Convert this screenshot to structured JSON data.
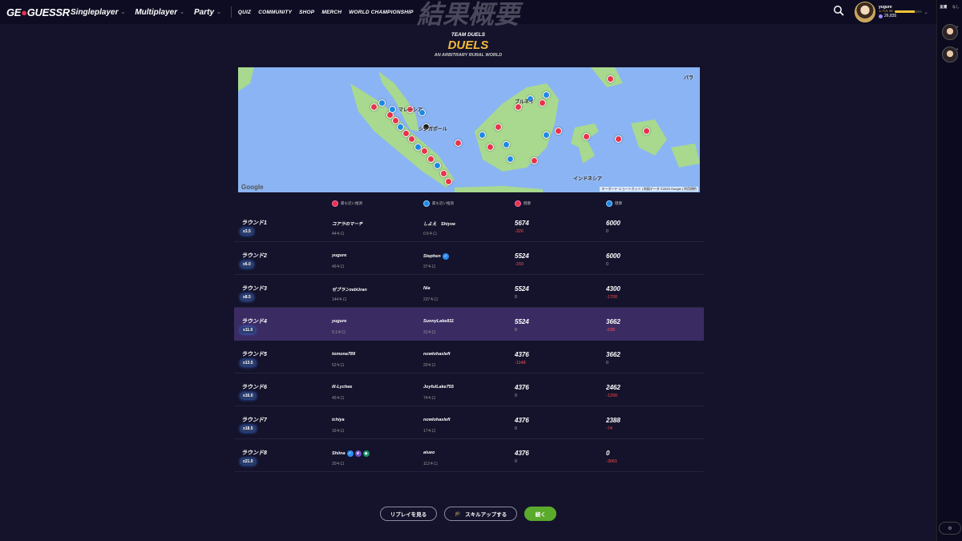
{
  "topbar": {
    "logo_left": "GE",
    "logo_right": "GUESSR",
    "nav_main": [
      {
        "label": "Singleplayer"
      },
      {
        "label": "Multiplayer"
      },
      {
        "label": "Party"
      }
    ],
    "nav_small": [
      {
        "label": "QUIZ"
      },
      {
        "label": "COMMUNITY"
      },
      {
        "label": "SHOP"
      },
      {
        "label": "MERCH"
      },
      {
        "label": "WORLD CHAMPIONSHIP"
      }
    ],
    "profile": {
      "name": "yugure",
      "level": "レベル 95",
      "level_progress": 0.75,
      "coins": "26,835"
    }
  },
  "sidebar": {
    "tab_friends": "友達",
    "tab_none": "なし"
  },
  "header": {
    "ghost_title": "結果概要",
    "mode": "TEAM DUELS",
    "title": "DUELS",
    "map_name": "AN ARBITRARY RURAL WORLD"
  },
  "map": {
    "labels": [
      "シンガポール",
      "ブルネイ",
      "インドネシア",
      "マレーシア",
      "バラ"
    ],
    "google": "Google",
    "attribution": "キーボード ショートカット | 地図データ ©2025 Google | 利用規約"
  },
  "columns": {
    "red_closest": "最も近い推測",
    "blue_closest": "最も近い推測",
    "red_health": "健康",
    "blue_health": "健康"
  },
  "rounds": [
    {
      "name": "ラウンド1",
      "mult": "x3.5",
      "red_player": "コアラのマーチ",
      "red_dist": "44キロ",
      "blue_player": "しよえ　Shiyoe",
      "blue_dist": "0.5キロ",
      "red_hp": "5674",
      "red_delta": "-326",
      "blue_hp": "6000",
      "blue_delta": "0"
    },
    {
      "name": "ラウンド2",
      "mult": "x6.0",
      "red_player": "yugure",
      "red_dist": "46キロ",
      "blue_player": "Stephen",
      "blue_dist": "37キロ",
      "red_hp": "5524",
      "red_delta": "-150",
      "blue_hp": "6000",
      "blue_delta": "0"
    },
    {
      "name": "ラウンド3",
      "mult": "x8.5",
      "red_player": "ゼブランzebUran",
      "red_dist": "144キロ",
      "blue_player": "Nia",
      "blue_dist": "237キロ",
      "red_hp": "5524",
      "red_delta": "0",
      "blue_hp": "4300",
      "blue_delta": "-1700"
    },
    {
      "name": "ラウンド4",
      "mult": "x11.0",
      "red_player": "yugure",
      "red_dist": "9.1キロ",
      "blue_player": "SunnyLake811",
      "blue_dist": "31キロ",
      "red_hp": "5524",
      "red_delta": "0",
      "blue_hp": "3662",
      "blue_delta": "-638"
    },
    {
      "name": "ラウンド5",
      "mult": "x13.5",
      "red_player": "tomona789",
      "red_dist": "52キロ",
      "blue_player": "nowlohasleft",
      "blue_dist": "20キロ",
      "red_hp": "4376",
      "red_delta": "-1148",
      "blue_hp": "3662",
      "blue_delta": "0"
    },
    {
      "name": "ラウンド6",
      "mult": "x16.0",
      "red_player": "ill-Lychee",
      "red_dist": "45キロ",
      "blue_player": "JoyfulLake755",
      "blue_dist": "74キロ",
      "red_hp": "4376",
      "red_delta": "0",
      "blue_hp": "2462",
      "blue_delta": "-1200"
    },
    {
      "name": "ラウンド7",
      "mult": "x18.5",
      "red_player": "ichiya",
      "red_dist": "16キロ",
      "blue_player": "nowlohasleft",
      "blue_dist": "17キロ",
      "red_hp": "4376",
      "red_delta": "0",
      "blue_hp": "2388",
      "blue_delta": "-74"
    },
    {
      "name": "ラウンド8",
      "mult": "x21.0",
      "red_player": "Shiina",
      "red_dist": "20キロ",
      "blue_player": "aiueo",
      "blue_dist": "112キロ",
      "red_hp": "4376",
      "red_delta": "0",
      "blue_hp": "0",
      "blue_delta": "-3061"
    }
  ],
  "buttons": {
    "replay": "リプレイを見る",
    "skillup": "スキルアップする",
    "continue": "続く"
  }
}
